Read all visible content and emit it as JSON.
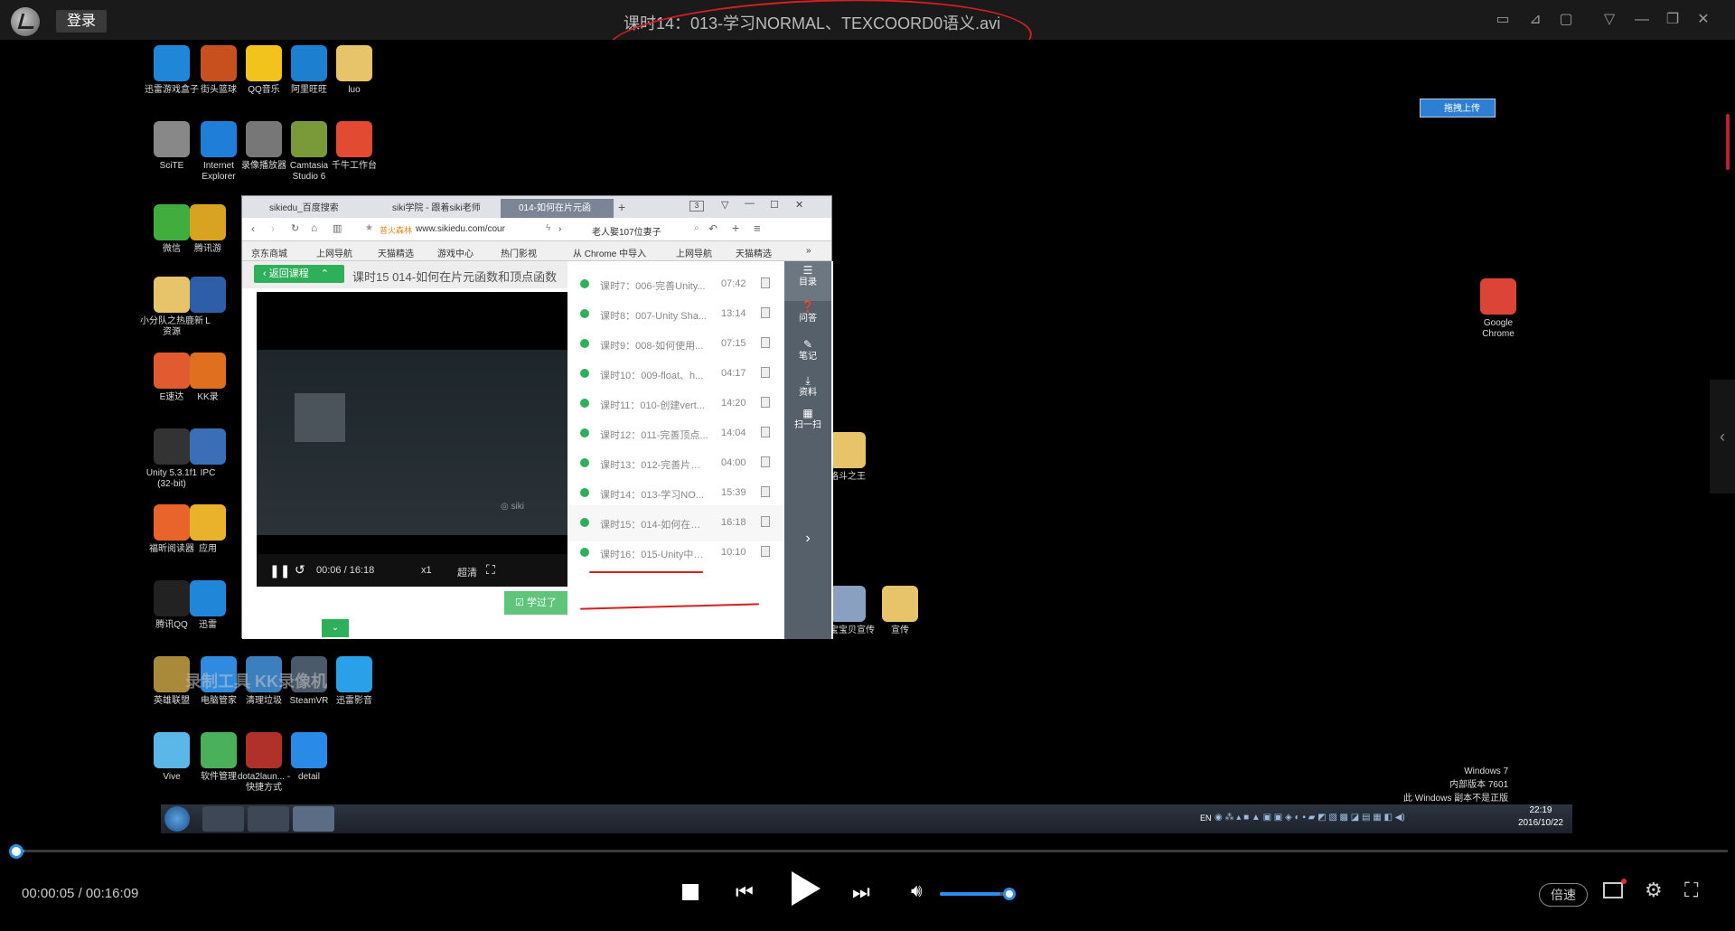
{
  "player": {
    "login_label": "登录",
    "title": "课时14：013-学习NORMAL、TEXCOORD0语义.avi",
    "current_time": "00:00:05",
    "separator": "/",
    "total_time": "00:16:09",
    "speed_label": "倍速",
    "progress_fraction": 0.005,
    "volume_fraction": 0.88
  },
  "upload_badge": "拖拽上传",
  "desktop_icons": [
    {
      "label": "迅雷游戏盒子",
      "color": "#1f86d8"
    },
    {
      "label": "街头篮球",
      "color": "#c8501e"
    },
    {
      "label": "QQ音乐",
      "color": "#f2c21d"
    },
    {
      "label": "阿里旺旺",
      "color": "#1d7fd0"
    },
    {
      "label": "luo",
      "color": "#e7c46a"
    },
    {
      "label": "SciTE",
      "color": "#888888"
    },
    {
      "label": "Internet Explorer",
      "color": "#1f7fd8"
    },
    {
      "label": "录像播放器",
      "color": "#777777"
    },
    {
      "label": "Camtasia Studio 6",
      "color": "#7a9a3a"
    },
    {
      "label": "千牛工作台",
      "color": "#e24a32"
    },
    {
      "label": "微信",
      "color": "#3fae3f"
    },
    {
      "label": "腾讯游",
      "color": "#d9a322"
    },
    {
      "label": "小分队之热鹿新资源",
      "color": "#e7c46a"
    },
    {
      "label": "L",
      "color": "#2f5ea8"
    },
    {
      "label": "E速达",
      "color": "#e25a30"
    },
    {
      "label": "KK录",
      "color": "#e07020"
    },
    {
      "label": "Unity 5.3.1f1 (32-bit)",
      "color": "#333333"
    },
    {
      "label": "IPC",
      "color": "#3a6fb8"
    },
    {
      "label": "福昕阅读器",
      "color": "#e8642a"
    },
    {
      "label": "应用",
      "color": "#e8b22a"
    },
    {
      "label": "腾讯QQ",
      "color": "#222222"
    },
    {
      "label": "迅雷",
      "color": "#1f86d8"
    },
    {
      "label": "英雄联盟",
      "color": "#a88a3a"
    },
    {
      "label": "电脑管家",
      "color": "#2f8ae0"
    },
    {
      "label": "清理垃圾",
      "color": "#3c7fbf"
    },
    {
      "label": "SteamVR",
      "color": "#4b5a6a"
    },
    {
      "label": "迅雷影音",
      "color": "#2aa0e8"
    },
    {
      "label": "Vive",
      "color": "#5ab7e8"
    },
    {
      "label": "软件管理",
      "color": "#4ab05a"
    },
    {
      "label": "dota2laun... - 快捷方式",
      "color": "#b0302a"
    },
    {
      "label": "detail",
      "color": "#2a8ae8"
    },
    {
      "label": "Google Chrome",
      "color": "#db4437"
    },
    {
      "label": "格斗之王",
      "color": "#e7c46a"
    },
    {
      "label": "淘宝宝贝宣传",
      "color": "#8aa0c0"
    },
    {
      "label": "宣传",
      "color": "#e7c46a"
    }
  ],
  "recorder_watermark": "录制工具 KK录像机",
  "browser": {
    "tabs": [
      "sikiedu_百度搜索",
      "siki学院 - 跟着siki老师",
      "014-如何在片元函"
    ],
    "tab_count": "3",
    "url": "www.sikiedu.com/cour",
    "site_label": "普火森林",
    "search_text": "老人娶107位妻子",
    "bookmarks": [
      "京东商城",
      "上网导航",
      "天猫精选",
      "游戏中心",
      "热门影视",
      "从 Chrome 中导入",
      "上网导航",
      "天猫精选"
    ],
    "back_label": "返回课程",
    "course_title": "课时15  014-如何在片元函数和顶点函数",
    "mini_time": "00:06 / 16:18",
    "mini_speed": "x1",
    "mini_quality": "超清",
    "studied_label": "学过了",
    "lessons": [
      {
        "name": "课时7：006-完善Unity...",
        "dur": "07:42"
      },
      {
        "name": "课时8：007-Unity Sha...",
        "dur": "13:14"
      },
      {
        "name": "课时9：008-如何使用...",
        "dur": "07:15"
      },
      {
        "name": "课时10：009-float、h...",
        "dur": "04:17"
      },
      {
        "name": "课时11：010-创建vert...",
        "dur": "14:20"
      },
      {
        "name": "课时12：011-完善顶点...",
        "dur": "14:04"
      },
      {
        "name": "课时13：012-完善片元...",
        "dur": "04:00"
      },
      {
        "name": "课时14：013-学习NO...",
        "dur": "15:39"
      },
      {
        "name": "课时15：014-如何在片...",
        "dur": "16:18"
      },
      {
        "name": "课时16：015-Unity中的...",
        "dur": "10:10"
      }
    ],
    "side_nav": [
      "目录",
      "问答",
      "笔记",
      "资料",
      "扫一扫"
    ]
  },
  "tray": {
    "lang": "EN",
    "time": "22:19",
    "date": "2016/10/22"
  },
  "windows_watermark": [
    "Windows 7",
    "内部版本 7601",
    "此 Windows 副本不是正版"
  ]
}
